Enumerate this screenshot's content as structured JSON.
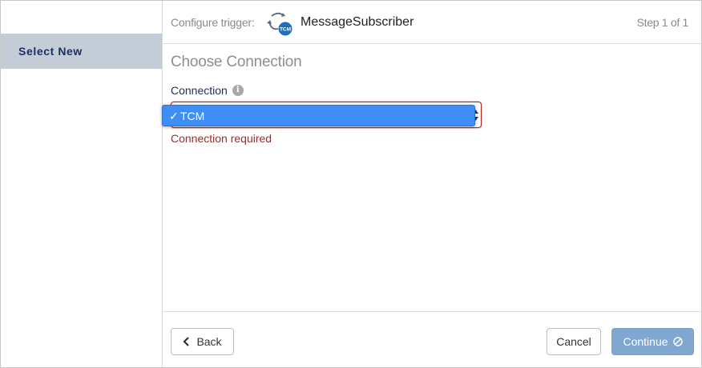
{
  "sidebar": {
    "items": [
      {
        "label": "Select New"
      }
    ]
  },
  "header": {
    "configure_label": "Configure trigger:",
    "trigger_name": "MessageSubscriber",
    "trigger_icon_badge": "TCM",
    "step": "Step 1 of 1"
  },
  "content": {
    "section_title": "Choose Connection",
    "connection_label": "Connection",
    "selected_option": "TCM",
    "check_mark": "✓",
    "error": "Connection required"
  },
  "footer": {
    "back_label": "Back",
    "cancel_label": "Cancel",
    "continue_label": "Continue"
  },
  "colors": {
    "sidebar_active_bg": "#c4ccd8",
    "accent_navy": "#1a2f5e",
    "error_red": "#a32a2a",
    "option_highlight": "#3e8ef7",
    "continue_disabled": "#7fa7d0"
  }
}
